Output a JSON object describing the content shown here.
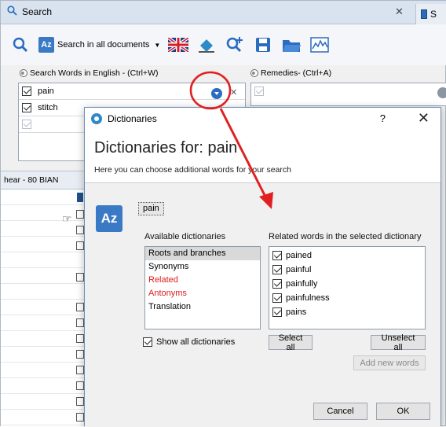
{
  "app": {
    "tab_title": "Search",
    "tab2_title": "S",
    "toolbar": {
      "search_all_label": "Search in all documents",
      "icons": [
        "search-icon",
        "az-dictionary-icon",
        "uk-flag-icon",
        "eraser-icon",
        "search-plus-icon",
        "save-icon",
        "folder-icon",
        "chart-icon"
      ]
    },
    "search_words_header": "Search Words in English - (Ctrl+W)",
    "remedies_header": "Remedies- (Ctrl+A)",
    "words": [
      {
        "text": "pain",
        "checked": true
      },
      {
        "text": "stitch",
        "checked": true
      },
      {
        "text": "",
        "checked": false
      }
    ],
    "hear_label": "hear - 80  BIAN"
  },
  "dialog": {
    "title": "Dictionaries",
    "help_label": "?",
    "close_label": "✕",
    "heading": "Dictionaries for: pain",
    "subtitle": "Here you can choose additional words for your search",
    "current_word": "pain",
    "available_label": "Available dictionaries",
    "dictionaries": [
      {
        "name": "Roots and branches",
        "selected": true,
        "color": "#000000"
      },
      {
        "name": "Synonyms",
        "selected": false,
        "color": "#000000"
      },
      {
        "name": "Related",
        "selected": false,
        "color": "#e01b1b"
      },
      {
        "name": "Antonyms",
        "selected": false,
        "color": "#e01b1b"
      },
      {
        "name": "Translation",
        "selected": false,
        "color": "#000000"
      }
    ],
    "related_label": "Related words in the selected dictionary",
    "related_words": [
      {
        "word": "pained",
        "checked": true
      },
      {
        "word": "painful",
        "checked": true
      },
      {
        "word": "painfully",
        "checked": true
      },
      {
        "word": "painfulness",
        "checked": true
      },
      {
        "word": "pains",
        "checked": true
      }
    ],
    "show_all_label": "Show all dictionaries",
    "show_all_checked": true,
    "select_all_label": "Select all",
    "unselect_all_label": "Unselect all",
    "add_new_words_label": "Add new words",
    "cancel_label": "Cancel",
    "ok_label": "OK"
  },
  "colors": {
    "accent": "#2b6bc1",
    "annotation_red": "#e02020"
  }
}
